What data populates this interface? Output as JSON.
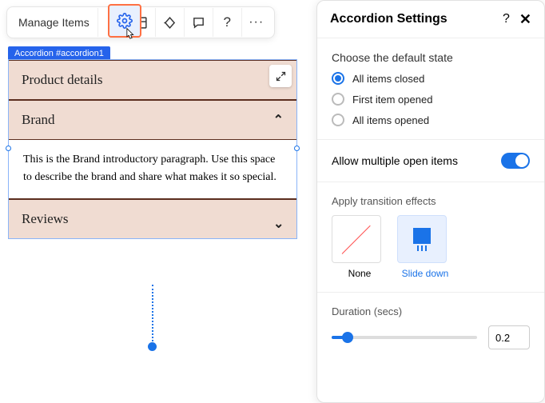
{
  "toolbar": {
    "manage_items": "Manage Items"
  },
  "breadcrumb": "Accordion #accordion1",
  "accordion": {
    "items": [
      {
        "title": "Product details",
        "open": false
      },
      {
        "title": "Brand",
        "open": true,
        "body": "This is the Brand introductory paragraph. Use this space to describe the brand and share what makes it so special."
      },
      {
        "title": "Reviews",
        "open": false
      }
    ]
  },
  "panel": {
    "title": "Accordion Settings",
    "default_state": {
      "label": "Choose the default state",
      "options": [
        "All items closed",
        "First item opened",
        "All items opened"
      ],
      "selected": 0
    },
    "multi_open": {
      "label": "Allow multiple open items",
      "value": true
    },
    "transition": {
      "label": "Apply transition effects",
      "options": [
        {
          "id": "none",
          "label": "None"
        },
        {
          "id": "slide",
          "label": "Slide down"
        }
      ],
      "selected": 1
    },
    "duration": {
      "label": "Duration (secs)",
      "value": "0.2"
    }
  }
}
